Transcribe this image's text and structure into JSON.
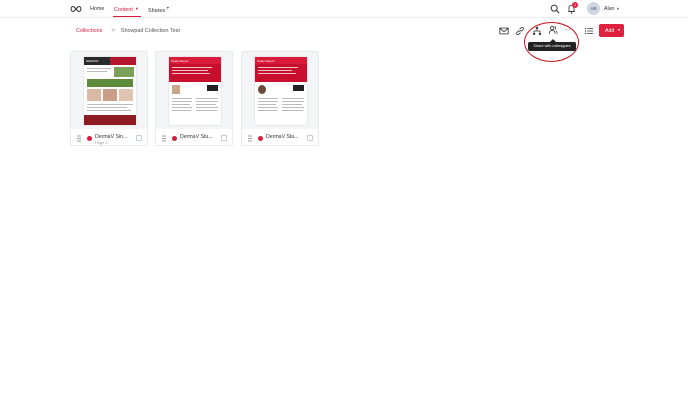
{
  "nav": {
    "items": [
      {
        "label": "Home"
      },
      {
        "label": "Content"
      },
      {
        "label": "Shares"
      }
    ],
    "notification_count": "1",
    "user": {
      "initials": "AB",
      "name": "Alan"
    }
  },
  "breadcrumb": {
    "parent": "Collections",
    "separator": ">",
    "current": "Showpad Collection Test"
  },
  "toolbar": {
    "add_label": "Add",
    "more_label": "···",
    "tooltip": "Share with colleagues"
  },
  "colors": {
    "accent": "#e0203f",
    "annotation_ring": "#c8141f"
  },
  "cards": [
    {
      "title": "DermaV Sin...",
      "subtitle": "Page 2"
    },
    {
      "title": "DermaV Stu...",
      "subtitle": ""
    },
    {
      "title": "DermaV Stu...",
      "subtitle": ""
    }
  ],
  "thumbnails": [
    {
      "headline": "DERMAV"
    },
    {
      "headline": "Study Report"
    },
    {
      "headline": "Study Report"
    }
  ],
  "icons": [
    "logo-icon",
    "search-icon",
    "bell-icon",
    "mail-icon",
    "link-icon",
    "tree-icon",
    "share-colleagues-icon",
    "more-icon",
    "list-view-icon",
    "drag-handle-icon"
  ]
}
